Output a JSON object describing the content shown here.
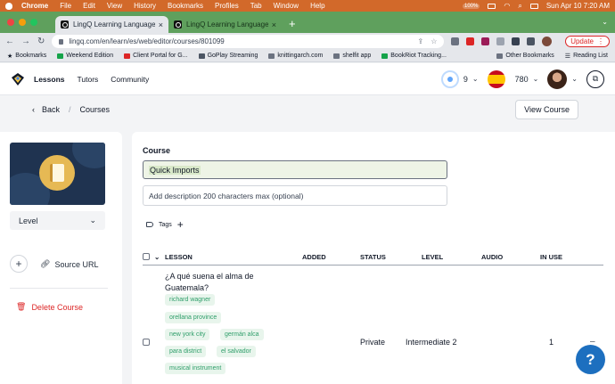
{
  "mac": {
    "app": "Chrome",
    "menus": [
      "File",
      "Edit",
      "View",
      "History",
      "Bookmarks",
      "Profiles",
      "Tab",
      "Window",
      "Help"
    ],
    "battery": "100%",
    "clock": "Sun Apr 10  7:20 AM"
  },
  "browser": {
    "tabs": [
      {
        "title": "LingQ Learning Languages Sim",
        "active": true
      },
      {
        "title": "LingQ Learning Languages Sim",
        "active": false
      }
    ],
    "new_tab": "+",
    "url": "lingq.com/en/learn/es/web/editor/courses/801099",
    "update_label": "Update"
  },
  "bookmarks": {
    "items": [
      "Bookmarks",
      "Weekend Edition",
      "Client Portal for G...",
      "GoPlay Streaming",
      "knittingarch.com",
      "shelfit app",
      "BookRiot Tracking..."
    ],
    "right": [
      "Other Bookmarks",
      "Reading List"
    ]
  },
  "header": {
    "nav": [
      "Lessons",
      "Tutors",
      "Community"
    ],
    "streak": "9",
    "coins": "780"
  },
  "breadcrumb": {
    "back": "Back",
    "current": "Courses",
    "view_course": "View Course"
  },
  "sidebar": {
    "level": "Level",
    "source_url": "Source URL",
    "delete_course": "Delete Course"
  },
  "course": {
    "label": "Course",
    "title": "Quick Imports",
    "description_placeholder": "Add description 200 characters max (optional)",
    "tags_label": "Tags"
  },
  "table": {
    "headers": [
      "LESSON",
      "ADDED",
      "STATUS",
      "LEVEL",
      "AUDIO",
      "IN USE"
    ],
    "rows": [
      {
        "title": "¿A qué suena el alma de Guatemala?",
        "tags": [
          "richard wagner",
          "orellana province",
          "new york city",
          "germán alca",
          "para district",
          "el salvador",
          "musical instrument"
        ],
        "status": "Private",
        "level": "Intermediate 2",
        "in_use": "1"
      }
    ]
  },
  "help": "?",
  "colors": {
    "accent_green": "#2f9e6a",
    "danger": "#dc2626",
    "mac_bar": "#d2692a",
    "tab_strip": "#5fa05d",
    "help_blue": "#1d6fbf"
  }
}
